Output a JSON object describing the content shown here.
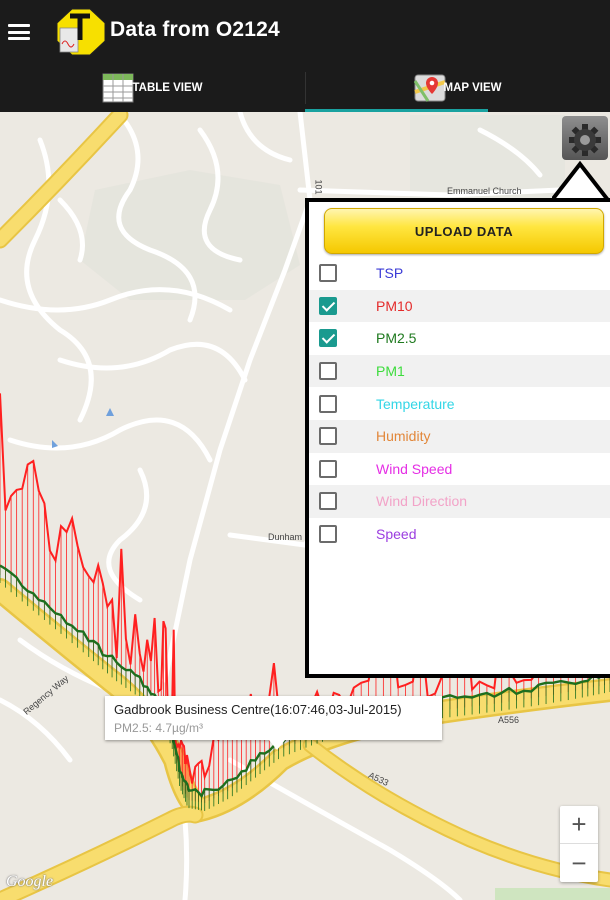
{
  "header": {
    "title": "Data from O2124",
    "menu_icon": "hamburger-menu-icon",
    "logo_icon": "app-logo-icon"
  },
  "tabs": [
    {
      "label": "TABLE VIEW",
      "icon": "table-icon",
      "active": false
    },
    {
      "label": "MAP VIEW",
      "icon": "map-pin-icon",
      "active": true
    }
  ],
  "panel": {
    "upload_label": "UPLOAD DATA",
    "options": [
      {
        "label": "TSP",
        "checked": false,
        "color": "#3b3bd6"
      },
      {
        "label": "PM10",
        "checked": true,
        "color": "#e42b2b"
      },
      {
        "label": "PM2.5",
        "checked": true,
        "color": "#1f7a1f"
      },
      {
        "label": "PM1",
        "checked": false,
        "color": "#3ddc3d"
      },
      {
        "label": "Temperature",
        "checked": false,
        "color": "#33d6e6"
      },
      {
        "label": "Humidity",
        "checked": false,
        "color": "#e2873a"
      },
      {
        "label": "Wind Speed",
        "checked": false,
        "color": "#e52ee5"
      },
      {
        "label": "Wind Direction",
        "checked": false,
        "color": "#f2a3c8"
      },
      {
        "label": "Speed",
        "checked": false,
        "color": "#9b3de0"
      }
    ]
  },
  "info_window": {
    "title": "Gadbrook Business Centre(16:07:46,03-Jul-2015)",
    "subtitle": "PM2.5: 4.7µg/m³"
  },
  "map_labels": {
    "church": "Emmanuel Church",
    "dunham": "Dunham",
    "regency": "Regency Way",
    "a556": "A556",
    "a533": "A533",
    "road_101": "101"
  },
  "zoom": {
    "in": "+",
    "out": "−"
  },
  "attribution": "Google",
  "colors": {
    "pm10_line": "#ff2020",
    "pm25_line": "#1e6e1e",
    "road_major": "#f6d95e",
    "accent": "#1aa2a0"
  }
}
